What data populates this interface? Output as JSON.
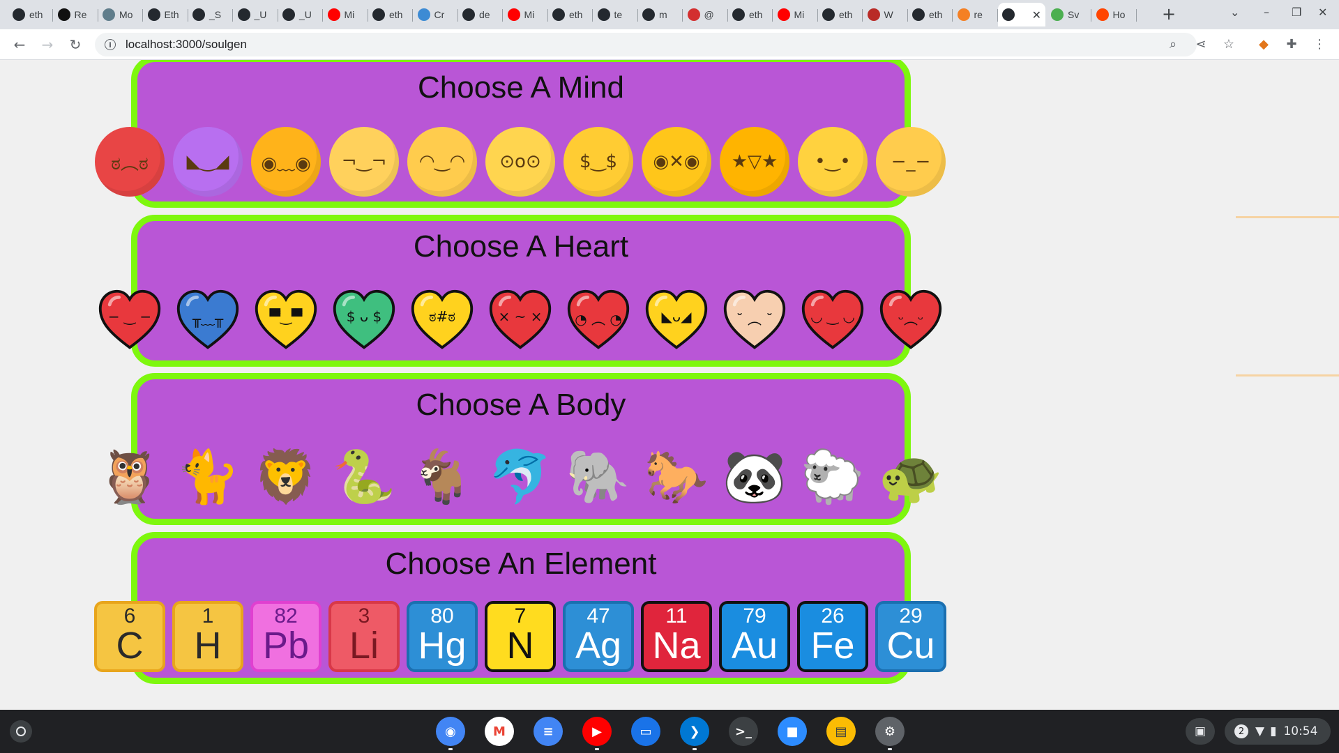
{
  "browser": {
    "tabs": [
      {
        "label": "eth",
        "icon": "github-cat-icon",
        "color": "#24292f"
      },
      {
        "label": "Re",
        "icon": "openai-icon",
        "color": "#111111"
      },
      {
        "label": "Mo",
        "icon": "app-icon",
        "color": "#607d8b"
      },
      {
        "label": "Eth",
        "icon": "github-cat-icon",
        "color": "#24292f"
      },
      {
        "label": "_S",
        "icon": "github-cat-icon",
        "color": "#24292f"
      },
      {
        "label": "_U",
        "icon": "github-cat-icon",
        "color": "#24292f"
      },
      {
        "label": "_U",
        "icon": "github-cat-icon",
        "color": "#24292f"
      },
      {
        "label": "Mi",
        "icon": "youtube-icon",
        "color": "#ff0000"
      },
      {
        "label": "eth",
        "icon": "github-cat-icon",
        "color": "#24292f"
      },
      {
        "label": "Cr",
        "icon": "app-icon",
        "color": "#3d8bd4"
      },
      {
        "label": "de",
        "icon": "github-icon",
        "color": "#24292f"
      },
      {
        "label": "Mi",
        "icon": "youtube-icon",
        "color": "#ff0000"
      },
      {
        "label": "eth",
        "icon": "github-icon",
        "color": "#24292f"
      },
      {
        "label": "te",
        "icon": "github-icon",
        "color": "#24292f"
      },
      {
        "label": "m",
        "icon": "github-icon",
        "color": "#24292f"
      },
      {
        "label": "@",
        "icon": "app-icon",
        "color": "#d32f2f"
      },
      {
        "label": "eth",
        "icon": "github-cat-icon",
        "color": "#24292f"
      },
      {
        "label": "Mi",
        "icon": "youtube-icon",
        "color": "#ff0000"
      },
      {
        "label": "eth",
        "icon": "github-cat-icon",
        "color": "#24292f"
      },
      {
        "label": "W",
        "icon": "quora-icon",
        "color": "#b92b27"
      },
      {
        "label": "eth",
        "icon": "github-cat-icon",
        "color": "#24292f"
      },
      {
        "label": "re",
        "icon": "stackoverflow-icon",
        "color": "#f48024"
      },
      {
        "label": "",
        "icon": "github-cat-icon",
        "color": "#24292f",
        "active": true
      },
      {
        "label": "Sv",
        "icon": "app-icon",
        "color": "#4caf50"
      },
      {
        "label": "Ho",
        "icon": "reddit-icon",
        "color": "#ff4500"
      }
    ],
    "url": "localhost:3000/soulgen"
  },
  "sections": [
    {
      "title": "Choose A Mind",
      "kind": "faces",
      "items": [
        {
          "name": "angry-face",
          "glyph": "ಠ︵ಠ",
          "color": "#e84545"
        },
        {
          "name": "smiling-devil-face",
          "glyph": "◣‿◢",
          "color": "#b86ff0"
        },
        {
          "name": "pleading-face",
          "glyph": "◉﹏◉",
          "color": "#ffb31a"
        },
        {
          "name": "thinking-face",
          "glyph": "¬‿¬",
          "color": "#ffd15c"
        },
        {
          "name": "smirking-face",
          "glyph": "◠‿◠",
          "color": "#ffcc4d"
        },
        {
          "name": "astonished-face",
          "glyph": "⊙o⊙",
          "color": "#ffd54f"
        },
        {
          "name": "money-mouth-face",
          "glyph": "$‿$",
          "color": "#ffcc33"
        },
        {
          "name": "zipped-eyes-face",
          "glyph": "◉✕◉",
          "color": "#ffc61a"
        },
        {
          "name": "star-struck-face",
          "glyph": "★▽★",
          "color": "#ffb400"
        },
        {
          "name": "smiling-face",
          "glyph": "•‿•",
          "color": "#ffd23f"
        },
        {
          "name": "pensive-face",
          "glyph": "−_−",
          "color": "#ffcc4d"
        }
      ]
    },
    {
      "title": "Choose A Heart",
      "kind": "hearts",
      "items": [
        {
          "name": "neutral-heart",
          "color": "#e8383d",
          "face": "− ‿ −"
        },
        {
          "name": "crying-heart",
          "color": "#3b7bd1",
          "face": "╥﹏╥"
        },
        {
          "name": "cool-heart",
          "color": "#ffd21e",
          "face": "▀̿‿▀̿"
        },
        {
          "name": "money-heart",
          "color": "#3fbf7f",
          "face": "$ ᴗ $"
        },
        {
          "name": "zipped-heart",
          "color": "#ffd21e",
          "face": "ಠ#ಠ"
        },
        {
          "name": "dizzy-heart",
          "color": "#e8383d",
          "face": "× ~ ×"
        },
        {
          "name": "confused-heart",
          "color": "#e8383d",
          "face": "◔ ︵ ◔"
        },
        {
          "name": "devil-heart",
          "color": "#ffd21e",
          "face": "◣ᴗ◢"
        },
        {
          "name": "sick-heart",
          "color": "#f7cfb0",
          "face": "˘ ︵ ˘"
        },
        {
          "name": "content-heart",
          "color": "#e8383d",
          "face": "◡ ‿ ◡"
        },
        {
          "name": "stormy-heart",
          "color": "#e8383d",
          "face": "ᵕ︵ᵕ"
        }
      ]
    },
    {
      "title": "Choose A Body",
      "kind": "animals",
      "items": [
        {
          "name": "owl",
          "glyph": "🦉"
        },
        {
          "name": "panther",
          "glyph": "🐈"
        },
        {
          "name": "lion",
          "glyph": "🦁"
        },
        {
          "name": "snake",
          "glyph": "🐍"
        },
        {
          "name": "goat",
          "glyph": "🐐"
        },
        {
          "name": "dolphin",
          "glyph": "🐬"
        },
        {
          "name": "elephant",
          "glyph": "🐘"
        },
        {
          "name": "horse",
          "glyph": "🐎"
        },
        {
          "name": "panda",
          "glyph": "🐼"
        },
        {
          "name": "sheep",
          "glyph": "🐑"
        },
        {
          "name": "turtle",
          "glyph": "🐢"
        }
      ]
    },
    {
      "title": "Choose An Element",
      "kind": "elements",
      "items": [
        {
          "name": "carbon",
          "number": "6",
          "symbol": "C",
          "bg": "#f5c542",
          "border": "#e8a51c",
          "text": "#2a2a2a"
        },
        {
          "name": "hydrogen",
          "number": "1",
          "symbol": "H",
          "bg": "#f5c542",
          "border": "#e8a51c",
          "text": "#2a2a2a"
        },
        {
          "name": "lead",
          "number": "82",
          "symbol": "Pb",
          "bg": "#f070e0",
          "border": "#e040d0",
          "text": "#6a1a8a"
        },
        {
          "name": "lithium",
          "number": "3",
          "symbol": "Li",
          "bg": "#ee5a66",
          "border": "#d83848",
          "text": "#7a1822"
        },
        {
          "name": "mercury",
          "number": "80",
          "symbol": "Hg",
          "bg": "#2d8fd6",
          "border": "#1b6fb0",
          "text": "#ffffff"
        },
        {
          "name": "nitrogen",
          "number": "7",
          "symbol": "N",
          "bg": "#ffdc1f",
          "border": "#111111",
          "text": "#111111"
        },
        {
          "name": "silver",
          "number": "47",
          "symbol": "Ag",
          "bg": "#2d8fd6",
          "border": "#1b6fb0",
          "text": "#ffffff"
        },
        {
          "name": "sodium",
          "number": "11",
          "symbol": "Na",
          "bg": "#e0253c",
          "border": "#111111",
          "text": "#ffffff"
        },
        {
          "name": "gold",
          "number": "79",
          "symbol": "Au",
          "bg": "#1a8de0",
          "border": "#111111",
          "text": "#ffffff"
        },
        {
          "name": "iron",
          "number": "26",
          "symbol": "Fe",
          "bg": "#1a8de0",
          "border": "#111111",
          "text": "#ffffff"
        },
        {
          "name": "copper",
          "number": "29",
          "symbol": "Cu",
          "bg": "#2d8fd6",
          "border": "#1b6fb0",
          "text": "#ffffff"
        }
      ]
    }
  ],
  "shelf": {
    "apps": [
      {
        "name": "chrome",
        "icon": "chrome-icon",
        "color": "#4285f4"
      },
      {
        "name": "gmail",
        "icon": "gmail-icon",
        "color": "#ffffff"
      },
      {
        "name": "docs",
        "icon": "docs-icon",
        "color": "#4285f4"
      },
      {
        "name": "youtube",
        "icon": "youtube-icon",
        "color": "#ff0000"
      },
      {
        "name": "files",
        "icon": "files-icon",
        "color": "#1a73e8"
      },
      {
        "name": "vscode",
        "icon": "vscode-icon",
        "color": "#0078d4"
      },
      {
        "name": "terminal",
        "icon": "terminal-icon",
        "color": "#3c4043"
      },
      {
        "name": "zoom",
        "icon": "zoom-icon",
        "color": "#2d8cff"
      },
      {
        "name": "keep",
        "icon": "notes-icon",
        "color": "#fbbc04"
      },
      {
        "name": "settings",
        "icon": "settings-icon",
        "color": "#5f6368"
      }
    ],
    "notifications": "2",
    "time": "10:54"
  }
}
